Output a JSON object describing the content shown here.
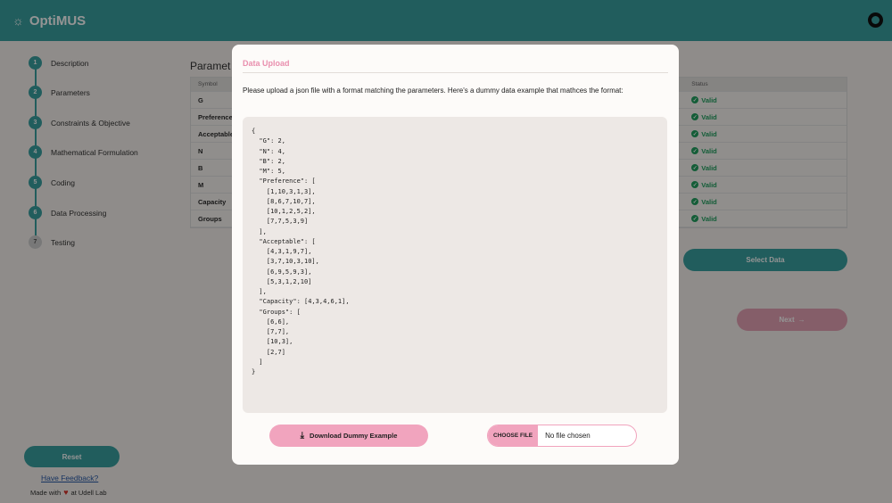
{
  "app": {
    "title": "OptiMUS",
    "logo_icon": "sun-icon",
    "github_icon": "github-icon"
  },
  "sidebar": {
    "steps": [
      {
        "num": "1",
        "label": "Description"
      },
      {
        "num": "2",
        "label": "Parameters"
      },
      {
        "num": "3",
        "label": "Constraints & Objective"
      },
      {
        "num": "4",
        "label": "Mathematical Formulation"
      },
      {
        "num": "5",
        "label": "Coding"
      },
      {
        "num": "6",
        "label": "Data Processing"
      },
      {
        "num": "7",
        "label": "Testing"
      }
    ],
    "reset_label": "Reset",
    "feedback_label": "Have Feedback?",
    "made_with_prefix": "Made with",
    "made_with_suffix": "at Udell Lab"
  },
  "main": {
    "title": "Paramet",
    "table": {
      "headers": {
        "symbol": "Symbol",
        "status": "Status"
      },
      "rows": [
        {
          "symbol": "G",
          "status": "Valid"
        },
        {
          "symbol": "Preference",
          "status": "Valid"
        },
        {
          "symbol": "Acceptable",
          "status": "Valid"
        },
        {
          "symbol": "N",
          "status": "Valid"
        },
        {
          "symbol": "B",
          "status": "Valid"
        },
        {
          "symbol": "M",
          "status": "Valid"
        },
        {
          "symbol": "Capacity",
          "status": "Valid"
        },
        {
          "symbol": "Groups",
          "status": "Valid"
        }
      ]
    },
    "select_data_label": "Select Data",
    "next_label": "Next",
    "next_arrow": "→"
  },
  "modal": {
    "title": "Data Upload",
    "description": "Please upload a json file with a format matching the parameters. Here's a dummy data example that mathces the format:",
    "code": "{\n  \"G\": 2,\n  \"N\": 4,\n  \"B\": 2,\n  \"M\": 5,\n  \"Preference\": [\n    [1,10,3,1,3],\n    [8,6,7,10,7],\n    [10,1,2,5,2],\n    [7,7,5,3,9]\n  ],\n  \"Acceptable\": [\n    [4,3,1,9,7],\n    [3,7,10,3,10],\n    [6,9,5,9,3],\n    [5,3,1,2,10]\n  ],\n  \"Capacity\": [4,3,4,6,1],\n  \"Groups\": [\n    [6,6],\n    [7,7],\n    [10,3],\n    [2,7]\n  ]\n}",
    "download_label": "Download Dummy Example",
    "choose_file_label": "CHOOSE FILE",
    "file_status": "No file chosen"
  }
}
